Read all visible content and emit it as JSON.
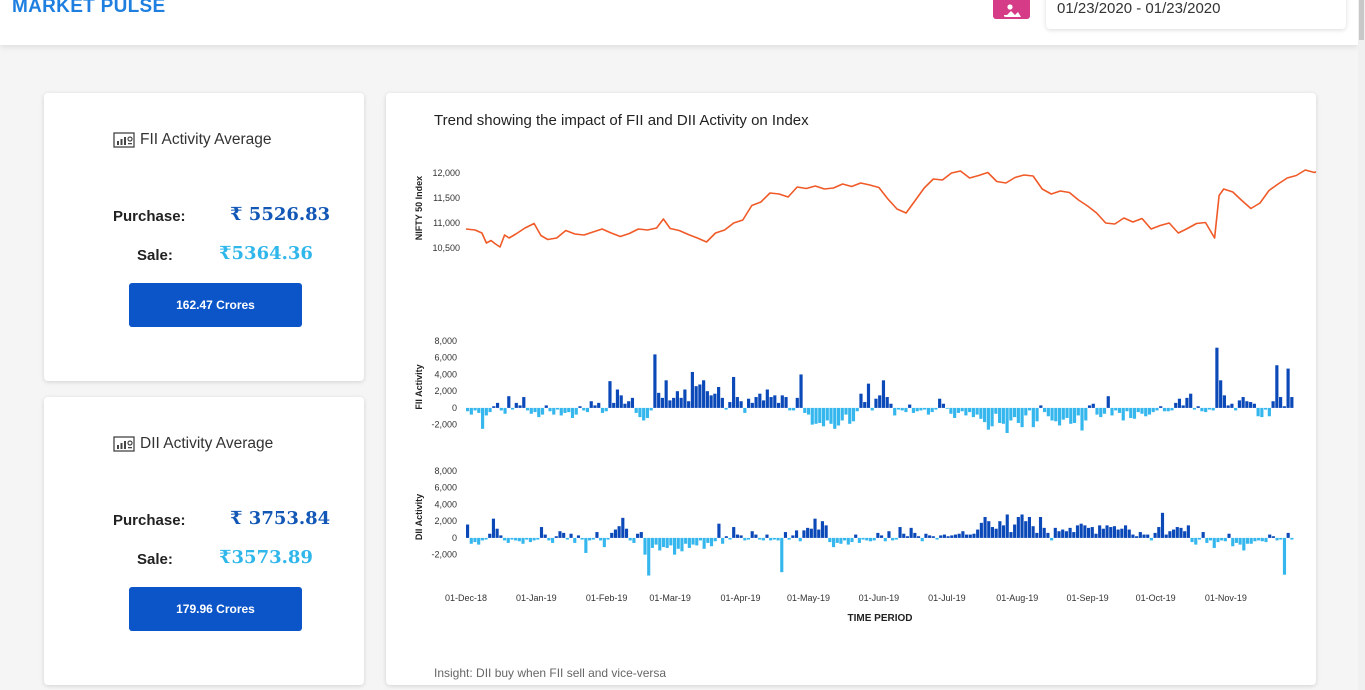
{
  "header": {
    "brand": "MARKET PULSE",
    "date_range": "01/23/2020 - 01/23/2020",
    "calendar_icon": "calendar-image-icon",
    "accent": "#d63b87",
    "brand_color": "#1f7fe0"
  },
  "fii_card": {
    "title": "FII Activity Average",
    "icon": "chart-report-icon",
    "purchase_label": "Purchase:",
    "purchase_value": "₹ 5526.83",
    "sale_label": "Sale:",
    "sale_value": "₹5364.36",
    "net_button": "162.47 Crores"
  },
  "dii_card": {
    "title": "DII Activity Average",
    "icon": "chart-report-icon",
    "purchase_label": "Purchase:",
    "purchase_value": "₹ 3753.84",
    "sale_label": "Sale:",
    "sale_value": "₹3573.89",
    "net_button": "179.96 Crores"
  },
  "chart_panel": {
    "title": "Trend showing the impact of FII and DII Activity on Index",
    "insight": "Insight: DII buy when FII sell and vice-versa"
  },
  "chart_data": [
    {
      "type": "line",
      "ylabel": "NIFTY 50 Index",
      "yticks": [
        "10,500",
        "11,000",
        "11,500",
        "12,000"
      ],
      "ylim": [
        10400,
        12200
      ],
      "color": "#f05a28",
      "x_range": [
        "01-Dec-18",
        "30-Nov-19"
      ],
      "series": [
        {
          "values": [
            [
              0,
              10880
            ],
            [
              4,
              10860
            ],
            [
              7,
              10800
            ],
            [
              9,
              10600
            ],
            [
              11,
              10650
            ],
            [
              13,
              10580
            ],
            [
              15,
              10520
            ],
            [
              17,
              10760
            ],
            [
              19,
              10700
            ],
            [
              22,
              10780
            ],
            [
              26,
              10900
            ],
            [
              30,
              10990
            ],
            [
              33,
              10750
            ],
            [
              36,
              10670
            ],
            [
              40,
              10700
            ],
            [
              44,
              10850
            ],
            [
              48,
              10780
            ],
            [
              52,
              10760
            ],
            [
              56,
              10820
            ],
            [
              60,
              10880
            ],
            [
              64,
              10800
            ],
            [
              68,
              10730
            ],
            [
              72,
              10790
            ],
            [
              76,
              10880
            ],
            [
              80,
              10860
            ],
            [
              84,
              10900
            ],
            [
              87,
              11080
            ],
            [
              90,
              10890
            ],
            [
              94,
              10850
            ],
            [
              98,
              10770
            ],
            [
              102,
              10700
            ],
            [
              106,
              10620
            ],
            [
              110,
              10800
            ],
            [
              114,
              10860
            ],
            [
              118,
              11000
            ],
            [
              122,
              11060
            ],
            [
              126,
              11350
            ],
            [
              130,
              11420
            ],
            [
              134,
              11600
            ],
            [
              138,
              11580
            ],
            [
              142,
              11520
            ],
            [
              146,
              11720
            ],
            [
              150,
              11690
            ],
            [
              154,
              11740
            ],
            [
              158,
              11680
            ],
            [
              162,
              11700
            ],
            [
              166,
              11780
            ],
            [
              170,
              11730
            ],
            [
              174,
              11800
            ],
            [
              178,
              11760
            ],
            [
              182,
              11710
            ],
            [
              186,
              11480
            ],
            [
              190,
              11280
            ],
            [
              194,
              11200
            ],
            [
              198,
              11450
            ],
            [
              202,
              11700
            ],
            [
              206,
              11880
            ],
            [
              210,
              11860
            ],
            [
              214,
              12000
            ],
            [
              218,
              12040
            ],
            [
              222,
              11900
            ],
            [
              226,
              11950
            ],
            [
              230,
              12010
            ],
            [
              234,
              11830
            ],
            [
              238,
              11800
            ],
            [
              242,
              11910
            ],
            [
              246,
              11960
            ],
            [
              250,
              11940
            ],
            [
              254,
              11680
            ],
            [
              258,
              11580
            ],
            [
              262,
              11640
            ],
            [
              266,
              11610
            ],
            [
              270,
              11460
            ],
            [
              274,
              11340
            ],
            [
              278,
              11200
            ],
            [
              282,
              11000
            ],
            [
              286,
              10980
            ],
            [
              290,
              11100
            ],
            [
              294,
              11020
            ],
            [
              298,
              11090
            ],
            [
              302,
              10880
            ],
            [
              306,
              10950
            ],
            [
              310,
              11000
            ],
            [
              314,
              10800
            ],
            [
              318,
              10890
            ],
            [
              322,
              10990
            ],
            [
              326,
              11010
            ],
            [
              330,
              10700
            ],
            [
              332,
              11550
            ],
            [
              334,
              11680
            ],
            [
              338,
              11620
            ],
            [
              342,
              11450
            ],
            [
              346,
              11290
            ],
            [
              350,
              11400
            ],
            [
              354,
              11650
            ],
            [
              358,
              11780
            ],
            [
              362,
              11900
            ],
            [
              366,
              11950
            ],
            [
              370,
              12060
            ],
            [
              374,
              12010
            ],
            [
              378,
              12080
            ],
            [
              382,
              11980
            ],
            [
              386,
              12030
            ],
            [
              390,
              12100
            ],
            [
              394,
              12090
            ],
            [
              398,
              12180
            ]
          ]
        }
      ]
    },
    {
      "type": "bar",
      "ylabel": "FII Activity",
      "yticks": [
        "-2,000",
        "0",
        "2,000",
        "4,000",
        "6,000",
        "8,000"
      ],
      "ylim": [
        -3000,
        8000
      ],
      "positive_color": "#0c49b8",
      "negative_color": "#35b7ee",
      "series": [
        {
          "values": [
            -400,
            -800,
            -300,
            -600,
            -2500,
            -900,
            -500,
            200,
            600,
            -300,
            -700,
            1400,
            -200,
            600,
            300,
            1300,
            -300,
            -700,
            -500,
            -1100,
            -800,
            300,
            -400,
            -800,
            -200,
            -900,
            -600,
            -500,
            -1200,
            -800,
            200,
            -300,
            -500,
            800,
            300,
            600,
            -600,
            -400,
            3200,
            600,
            2200,
            1500,
            500,
            800,
            1200,
            -600,
            -1100,
            -1500,
            -1200,
            -300,
            6400,
            1800,
            1200,
            3300,
            900,
            1200,
            2000,
            1200,
            2200,
            800,
            4300,
            2600,
            2800,
            3300,
            2000,
            1500,
            1700,
            2500,
            1200,
            -200,
            700,
            3700,
            1300,
            800,
            -600,
            1100,
            600,
            1300,
            1700,
            900,
            2200,
            1300,
            1500,
            600,
            1500,
            1300,
            -300,
            -300,
            1200,
            4000,
            -600,
            -800,
            -2000,
            -1900,
            -1800,
            -2200,
            -1500,
            -1900,
            -2500,
            -2100,
            -1500,
            -800,
            -1900,
            -1600,
            -400,
            1700,
            700,
            2900,
            -300,
            1100,
            1500,
            3300,
            1300,
            500,
            -900,
            -200,
            -300,
            -500,
            400,
            -600,
            -400,
            -300,
            -200,
            -800,
            -500,
            -200,
            1100,
            500,
            -100,
            -700,
            -1200,
            -600,
            -400,
            -900,
            -500,
            -1100,
            -800,
            -1300,
            -1700,
            -2600,
            -2200,
            -700,
            -1800,
            -1900,
            -3000,
            -1500,
            -1100,
            -1800,
            -2300,
            -900,
            -300,
            -2300,
            -1600,
            300,
            -500,
            -1000,
            -1500,
            -1600,
            -2100,
            -1400,
            -1200,
            -1900,
            -1800,
            -900,
            -2700,
            -1500,
            300,
            500,
            -800,
            -1100,
            -700,
            1400,
            -900,
            -300,
            -600,
            -1500,
            -400,
            -1200,
            -1300,
            -500,
            -700,
            -1000,
            -800,
            -500,
            -300,
            200,
            -400,
            -400,
            -300,
            600,
            1100,
            300,
            1200,
            1700,
            -200,
            200,
            -400,
            -500,
            -200,
            -300,
            7200,
            3300,
            1500,
            300,
            500,
            -300,
            900,
            1300,
            800,
            700,
            500,
            -1000,
            -1100,
            -200,
            -1000,
            800,
            5100,
            1300,
            200,
            4700,
            1300
          ]
        }
      ]
    },
    {
      "type": "bar",
      "ylabel": "DII Activity",
      "yticks": [
        "-2,000",
        "0",
        "2,000",
        "4,000",
        "6,000",
        "8,000"
      ],
      "ylim": [
        -3000,
        8000
      ],
      "positive_color": "#0c49b8",
      "negative_color": "#35b7ee",
      "xlabel": "TIME PERIOD",
      "categories": [
        "01-Dec-18",
        "01-Jan-19",
        "01-Feb-19",
        "01-Mar-19",
        "01-Apr-19",
        "01-May-19",
        "01-Jun-19",
        "01-Jul-19",
        "01-Aug-19",
        "01-Sep-19",
        "01-Oct-19",
        "01-Nov-19"
      ],
      "series": [
        {
          "values": [
            1600,
            -700,
            -500,
            -800,
            -300,
            -200,
            500,
            2300,
            1100,
            300,
            -300,
            -600,
            -200,
            -300,
            -400,
            -700,
            -200,
            -500,
            -300,
            -200,
            1300,
            400,
            -300,
            -600,
            200,
            800,
            600,
            -200,
            500,
            -600,
            300,
            -200,
            -1800,
            -300,
            -200,
            700,
            -300,
            -1100,
            -200,
            600,
            1000,
            1400,
            2400,
            1100,
            -300,
            -600,
            500,
            700,
            -2000,
            -4500,
            -1200,
            -800,
            -1500,
            -1100,
            -1200,
            -900,
            -2000,
            -1300,
            -1600,
            -700,
            -1200,
            -800,
            -900,
            -300,
            -1300,
            -600,
            -1000,
            -400,
            1700,
            -700,
            200,
            -200,
            1300,
            400,
            300,
            -300,
            -200,
            800,
            400,
            -200,
            -300,
            400,
            -300,
            -200,
            -300,
            -4100,
            700,
            -200,
            300,
            900,
            -400,
            900,
            1200,
            1100,
            2300,
            1000,
            2000,
            1500,
            -500,
            -1100,
            -600,
            -700,
            -300,
            -800,
            -500,
            400,
            -600,
            -200,
            -300,
            -400,
            -300,
            600,
            300,
            -400,
            800,
            -300,
            -200,
            1300,
            500,
            200,
            1200,
            600,
            200,
            -400,
            500,
            300,
            200,
            -200,
            300,
            400,
            200,
            300,
            400,
            500,
            800,
            400,
            400,
            500,
            1000,
            1800,
            2500,
            2000,
            1300,
            1100,
            2000,
            1500,
            2800,
            700,
            1600,
            2500,
            2800,
            2000,
            2500,
            1400,
            600,
            2500,
            1200,
            600,
            -300,
            1200,
            800,
            1000,
            800,
            1200,
            700,
            1500,
            1700,
            1500,
            1200,
            1300,
            500,
            1500,
            1100,
            1500,
            1300,
            1400,
            1000,
            1100,
            1500,
            1000,
            400,
            200,
            700,
            400,
            400,
            -300,
            600,
            1300,
            3000,
            400,
            800,
            1000,
            1300,
            1200,
            800,
            1500,
            -500,
            -800,
            -200,
            700,
            -600,
            -300,
            -1200,
            -500,
            -300,
            -400,
            500,
            -1000,
            -600,
            -800,
            -1500,
            -700,
            -700,
            -400,
            -300,
            -400,
            -500,
            400,
            200,
            -300,
            -200,
            -4400,
            600,
            -200
          ]
        }
      ]
    }
  ]
}
